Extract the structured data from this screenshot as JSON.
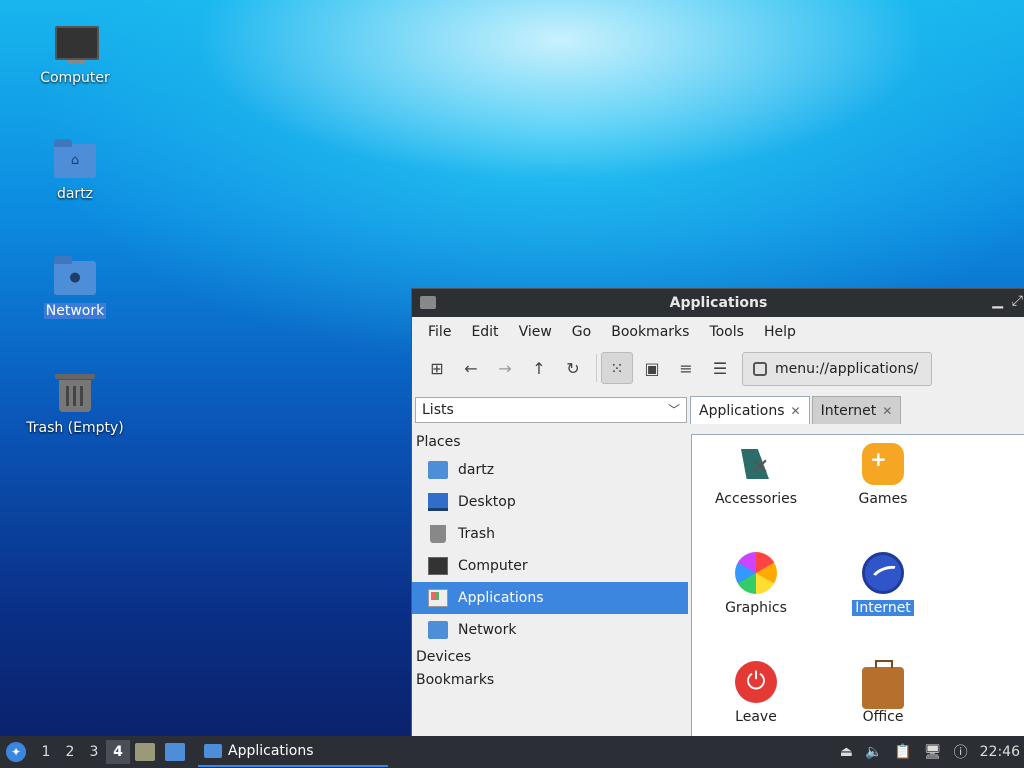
{
  "desktop": {
    "icons": [
      {
        "label": "Computer"
      },
      {
        "label": "dartz"
      },
      {
        "label": "Network"
      },
      {
        "label": "Trash (Empty)"
      }
    ]
  },
  "window": {
    "title": "Applications",
    "menu": [
      "File",
      "Edit",
      "View",
      "Go",
      "Bookmarks",
      "Tools",
      "Help"
    ],
    "address": "menu://applications/",
    "side_mode": "Lists",
    "tabs": [
      "Applications",
      "Internet"
    ],
    "sidebar": {
      "places_header": "Places",
      "places": [
        "dartz",
        "Desktop",
        "Trash",
        "Computer",
        "Applications",
        "Network"
      ],
      "devices_header": "Devices",
      "bookmarks_header": "Bookmarks"
    },
    "apps": [
      "Accessories",
      "Games",
      "Graphics",
      "Internet",
      "Leave",
      "Office"
    ]
  },
  "taskbar": {
    "workspaces": [
      "1",
      "2",
      "3",
      "4"
    ],
    "task_label": "Applications",
    "clock": "22:46"
  }
}
